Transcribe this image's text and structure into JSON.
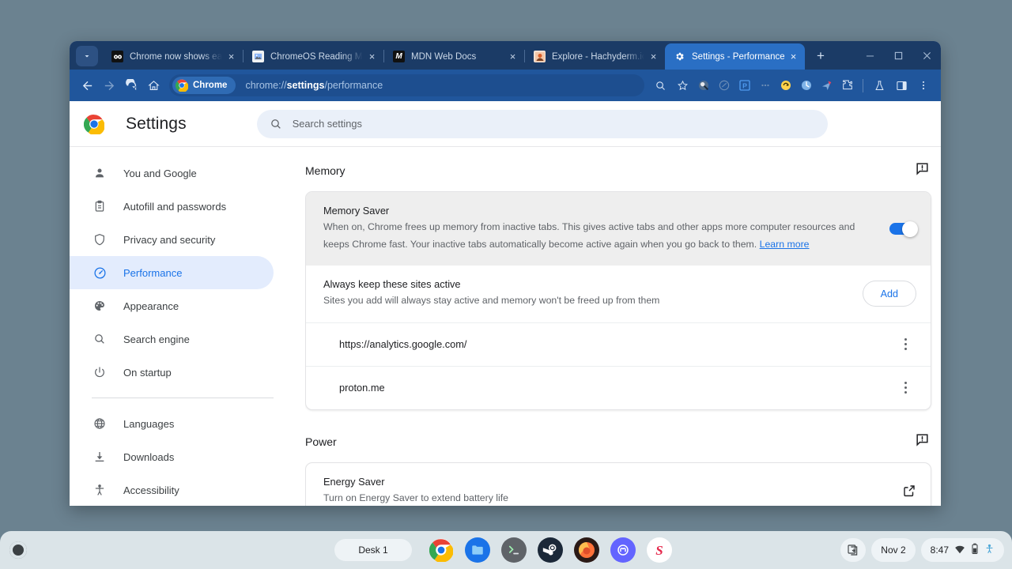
{
  "desktop": {
    "background_color": "#6b8290"
  },
  "browser": {
    "tabs": [
      {
        "title": "Chrome now shows each ac",
        "favicon": "news-icon",
        "active": false,
        "close_label": "×"
      },
      {
        "title": "ChromeOS Reading Mode is",
        "favicon": "image-icon",
        "active": false,
        "close_label": "×"
      },
      {
        "title": "MDN Web Docs",
        "favicon": "mdn-icon",
        "active": false,
        "close_label": "×"
      },
      {
        "title": "Explore - Hachyderm.io",
        "favicon": "mastodon-icon",
        "active": false,
        "close_label": "×"
      },
      {
        "title": "Settings - Performance",
        "favicon": "settings-gear-icon",
        "active": true,
        "close_label": "×"
      }
    ],
    "new_tab_label": "+",
    "tab_search_icon": "chevron-down-icon",
    "window_controls": {
      "minimize": "—",
      "maximize": "□",
      "close": "×"
    },
    "toolbar": {
      "back_icon": "back-arrow-icon",
      "forward_icon": "forward-arrow-icon",
      "reload_icon": "reload-icon",
      "home_icon": "home-icon",
      "chrome_chip_label": "Chrome",
      "url_prefix": "chrome://",
      "url_bold": "settings",
      "url_suffix": "/performance",
      "zoom_icon": "zoom-search-icon",
      "bookmark_icon": "star-icon",
      "extensions": [
        "extension-icon-1",
        "extension-icon-2",
        "extension-icon-3",
        "extension-icon-4",
        "extension-icon-5",
        "extension-icon-6",
        "extension-icon-7",
        "extension-puzzle-icon"
      ],
      "labs_icon": "flask-icon",
      "side_panel_icon": "side-panel-icon",
      "menu_icon": "three-dot-menu-icon"
    }
  },
  "settings": {
    "title": "Settings",
    "logo": "chrome-logo-icon",
    "search": {
      "placeholder": "Search settings",
      "icon": "search-icon",
      "value": ""
    },
    "sidebar": {
      "items": [
        {
          "label": "You and Google",
          "icon": "person-icon",
          "selected": false
        },
        {
          "label": "Autofill and passwords",
          "icon": "clipboard-icon",
          "selected": false
        },
        {
          "label": "Privacy and security",
          "icon": "shield-icon",
          "selected": false
        },
        {
          "label": "Performance",
          "icon": "speedometer-icon",
          "selected": true
        },
        {
          "label": "Appearance",
          "icon": "palette-icon",
          "selected": false
        },
        {
          "label": "Search engine",
          "icon": "search-icon",
          "selected": false
        },
        {
          "label": "On startup",
          "icon": "power-icon",
          "selected": false
        }
      ],
      "items2": [
        {
          "label": "Languages",
          "icon": "globe-icon",
          "selected": false
        },
        {
          "label": "Downloads",
          "icon": "download-icon",
          "selected": false
        },
        {
          "label": "Accessibility",
          "icon": "accessibility-icon",
          "selected": false
        }
      ]
    },
    "memory_section": {
      "heading": "Memory",
      "feedback_icon": "feedback-icon",
      "memory_saver": {
        "title": "Memory Saver",
        "description": "When on, Chrome frees up memory from inactive tabs. This gives active tabs and other apps more computer resources and keeps Chrome fast. Your inactive tabs automatically become active again when you go back to them.",
        "link_label": "Learn more",
        "toggle_on": true,
        "toggle_color": "#1a73e8"
      },
      "keep_active": {
        "title": "Always keep these sites active",
        "subtitle": "Sites you add will always stay active and memory won't be freed up from them",
        "add_label": "Add",
        "sites": [
          {
            "name": "https://analytics.google.com/",
            "menu_icon": "kebab-menu-icon"
          },
          {
            "name": "proton.me",
            "menu_icon": "kebab-menu-icon"
          }
        ]
      }
    },
    "power_section": {
      "heading": "Power",
      "feedback_icon": "feedback-icon",
      "energy_saver": {
        "title": "Energy Saver",
        "description": "Turn on Energy Saver to extend battery life",
        "external_icon": "external-link-icon"
      }
    }
  },
  "shelf": {
    "launcher_icon": "launcher-icon",
    "desk_label": "Desk 1",
    "apps": [
      {
        "name": "chrome-app-icon",
        "running": true
      },
      {
        "name": "files-app-icon",
        "running": false
      },
      {
        "name": "terminal-app-icon",
        "running": false
      },
      {
        "name": "steam-app-icon",
        "running": false
      },
      {
        "name": "firefox-app-icon",
        "running": false
      },
      {
        "name": "mastodon-app-icon",
        "running": false
      },
      {
        "name": "s-app-icon",
        "running": false
      }
    ],
    "status": {
      "screen_capture_icon": "screen-capture-icon",
      "date": "Nov 2",
      "time": "8:47",
      "wifi_icon": "wifi-icon",
      "battery_icon": "battery-icon",
      "accessibility_icon": "accessibility-status-icon"
    }
  }
}
